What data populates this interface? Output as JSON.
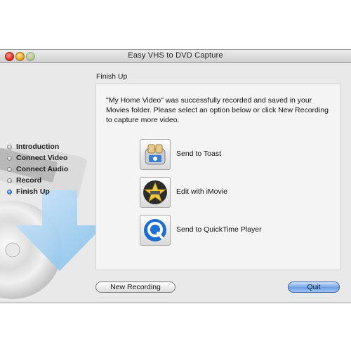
{
  "window": {
    "title": "Easy VHS to DVD Capture"
  },
  "steps": [
    {
      "label": "Introduction",
      "active": false
    },
    {
      "label": "Connect Video",
      "active": false
    },
    {
      "label": "Connect Audio",
      "active": false
    },
    {
      "label": "Record",
      "active": false
    },
    {
      "label": "Finish Up",
      "active": true
    }
  ],
  "main": {
    "section_title": "Finish Up",
    "message": "\"My Home Video\" was successfully recorded and saved in your Movies folder. Please select an option below or click New Recording to capture more video.",
    "options": [
      {
        "label": "Send to Toast",
        "icon": "toast-icon"
      },
      {
        "label": "Edit with iMovie",
        "icon": "imovie-star-icon"
      },
      {
        "label": "Send to QuickTime Player",
        "icon": "quicktime-icon"
      }
    ]
  },
  "buttons": {
    "new_recording": "New Recording",
    "quit": "Quit"
  },
  "colors": {
    "active_step": "#3f7fd6",
    "quit_button": "#6ea0e6",
    "window_bg": "#e9e9e9"
  }
}
